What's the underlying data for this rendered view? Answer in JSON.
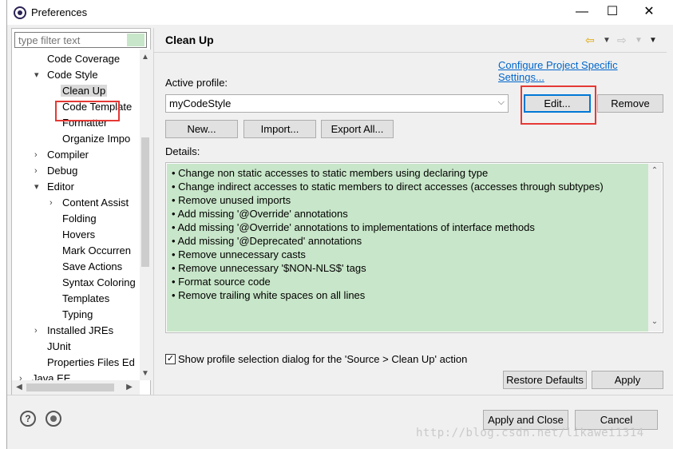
{
  "window": {
    "title": "Preferences",
    "minimize": "—",
    "maximize": "☐",
    "close": "✕"
  },
  "filter": {
    "placeholder": "type filter text"
  },
  "tree": {
    "items": [
      {
        "label": "Code Coverage",
        "arrow": ""
      },
      {
        "label": "Code Style",
        "arrow": "▾"
      },
      {
        "label": "Clean Up",
        "arrow": ""
      },
      {
        "label": "Code Template",
        "arrow": ""
      },
      {
        "label": "Formatter",
        "arrow": ""
      },
      {
        "label": "Organize Impo",
        "arrow": ""
      },
      {
        "label": "Compiler",
        "arrow": "›"
      },
      {
        "label": "Debug",
        "arrow": "›"
      },
      {
        "label": "Editor",
        "arrow": "▾"
      },
      {
        "label": "Content Assist",
        "arrow": "›"
      },
      {
        "label": "Folding",
        "arrow": ""
      },
      {
        "label": "Hovers",
        "arrow": ""
      },
      {
        "label": "Mark Occurren",
        "arrow": ""
      },
      {
        "label": "Save Actions",
        "arrow": ""
      },
      {
        "label": "Syntax Coloring",
        "arrow": ""
      },
      {
        "label": "Templates",
        "arrow": ""
      },
      {
        "label": "Typing",
        "arrow": ""
      },
      {
        "label": "Installed JREs",
        "arrow": "›"
      },
      {
        "label": "JUnit",
        "arrow": ""
      },
      {
        "label": "Properties Files Ed",
        "arrow": ""
      },
      {
        "label": "Java EE",
        "arrow": "›"
      }
    ]
  },
  "page": {
    "title": "Clean Up",
    "configure_link": "Configure Project Specific Settings...",
    "active_profile_label": "Active profile:",
    "profile_value": "myCodeStyle",
    "edit": "Edit...",
    "remove": "Remove",
    "new": "New...",
    "import": "Import...",
    "export": "Export All...",
    "details_label": "Details:",
    "details": [
      "Change non static accesses to static members using declaring type",
      "Change indirect accesses to static members to direct accesses (accesses through subtypes)",
      "Remove unused imports",
      "Add missing '@Override' annotations",
      "Add missing '@Override' annotations to implementations of interface methods",
      "Add missing '@Deprecated' annotations",
      "Remove unnecessary casts",
      "Remove unnecessary '$NON-NLS$' tags",
      "Format source code",
      "Remove trailing white spaces on all lines"
    ],
    "show_dialog_label": "Show profile selection dialog for the 'Source > Clean Up' action",
    "show_dialog_checked": true,
    "restore_defaults": "Restore Defaults",
    "apply": "Apply"
  },
  "footer": {
    "help_icon": "?",
    "apply_close": "Apply and Close",
    "cancel": "Cancel"
  },
  "watermark": "http://blog.csdn.net/likawei1314",
  "colors": {
    "details_bg": "#c8e6c9",
    "highlight_red": "#e53935",
    "link_blue": "#0066cc"
  }
}
